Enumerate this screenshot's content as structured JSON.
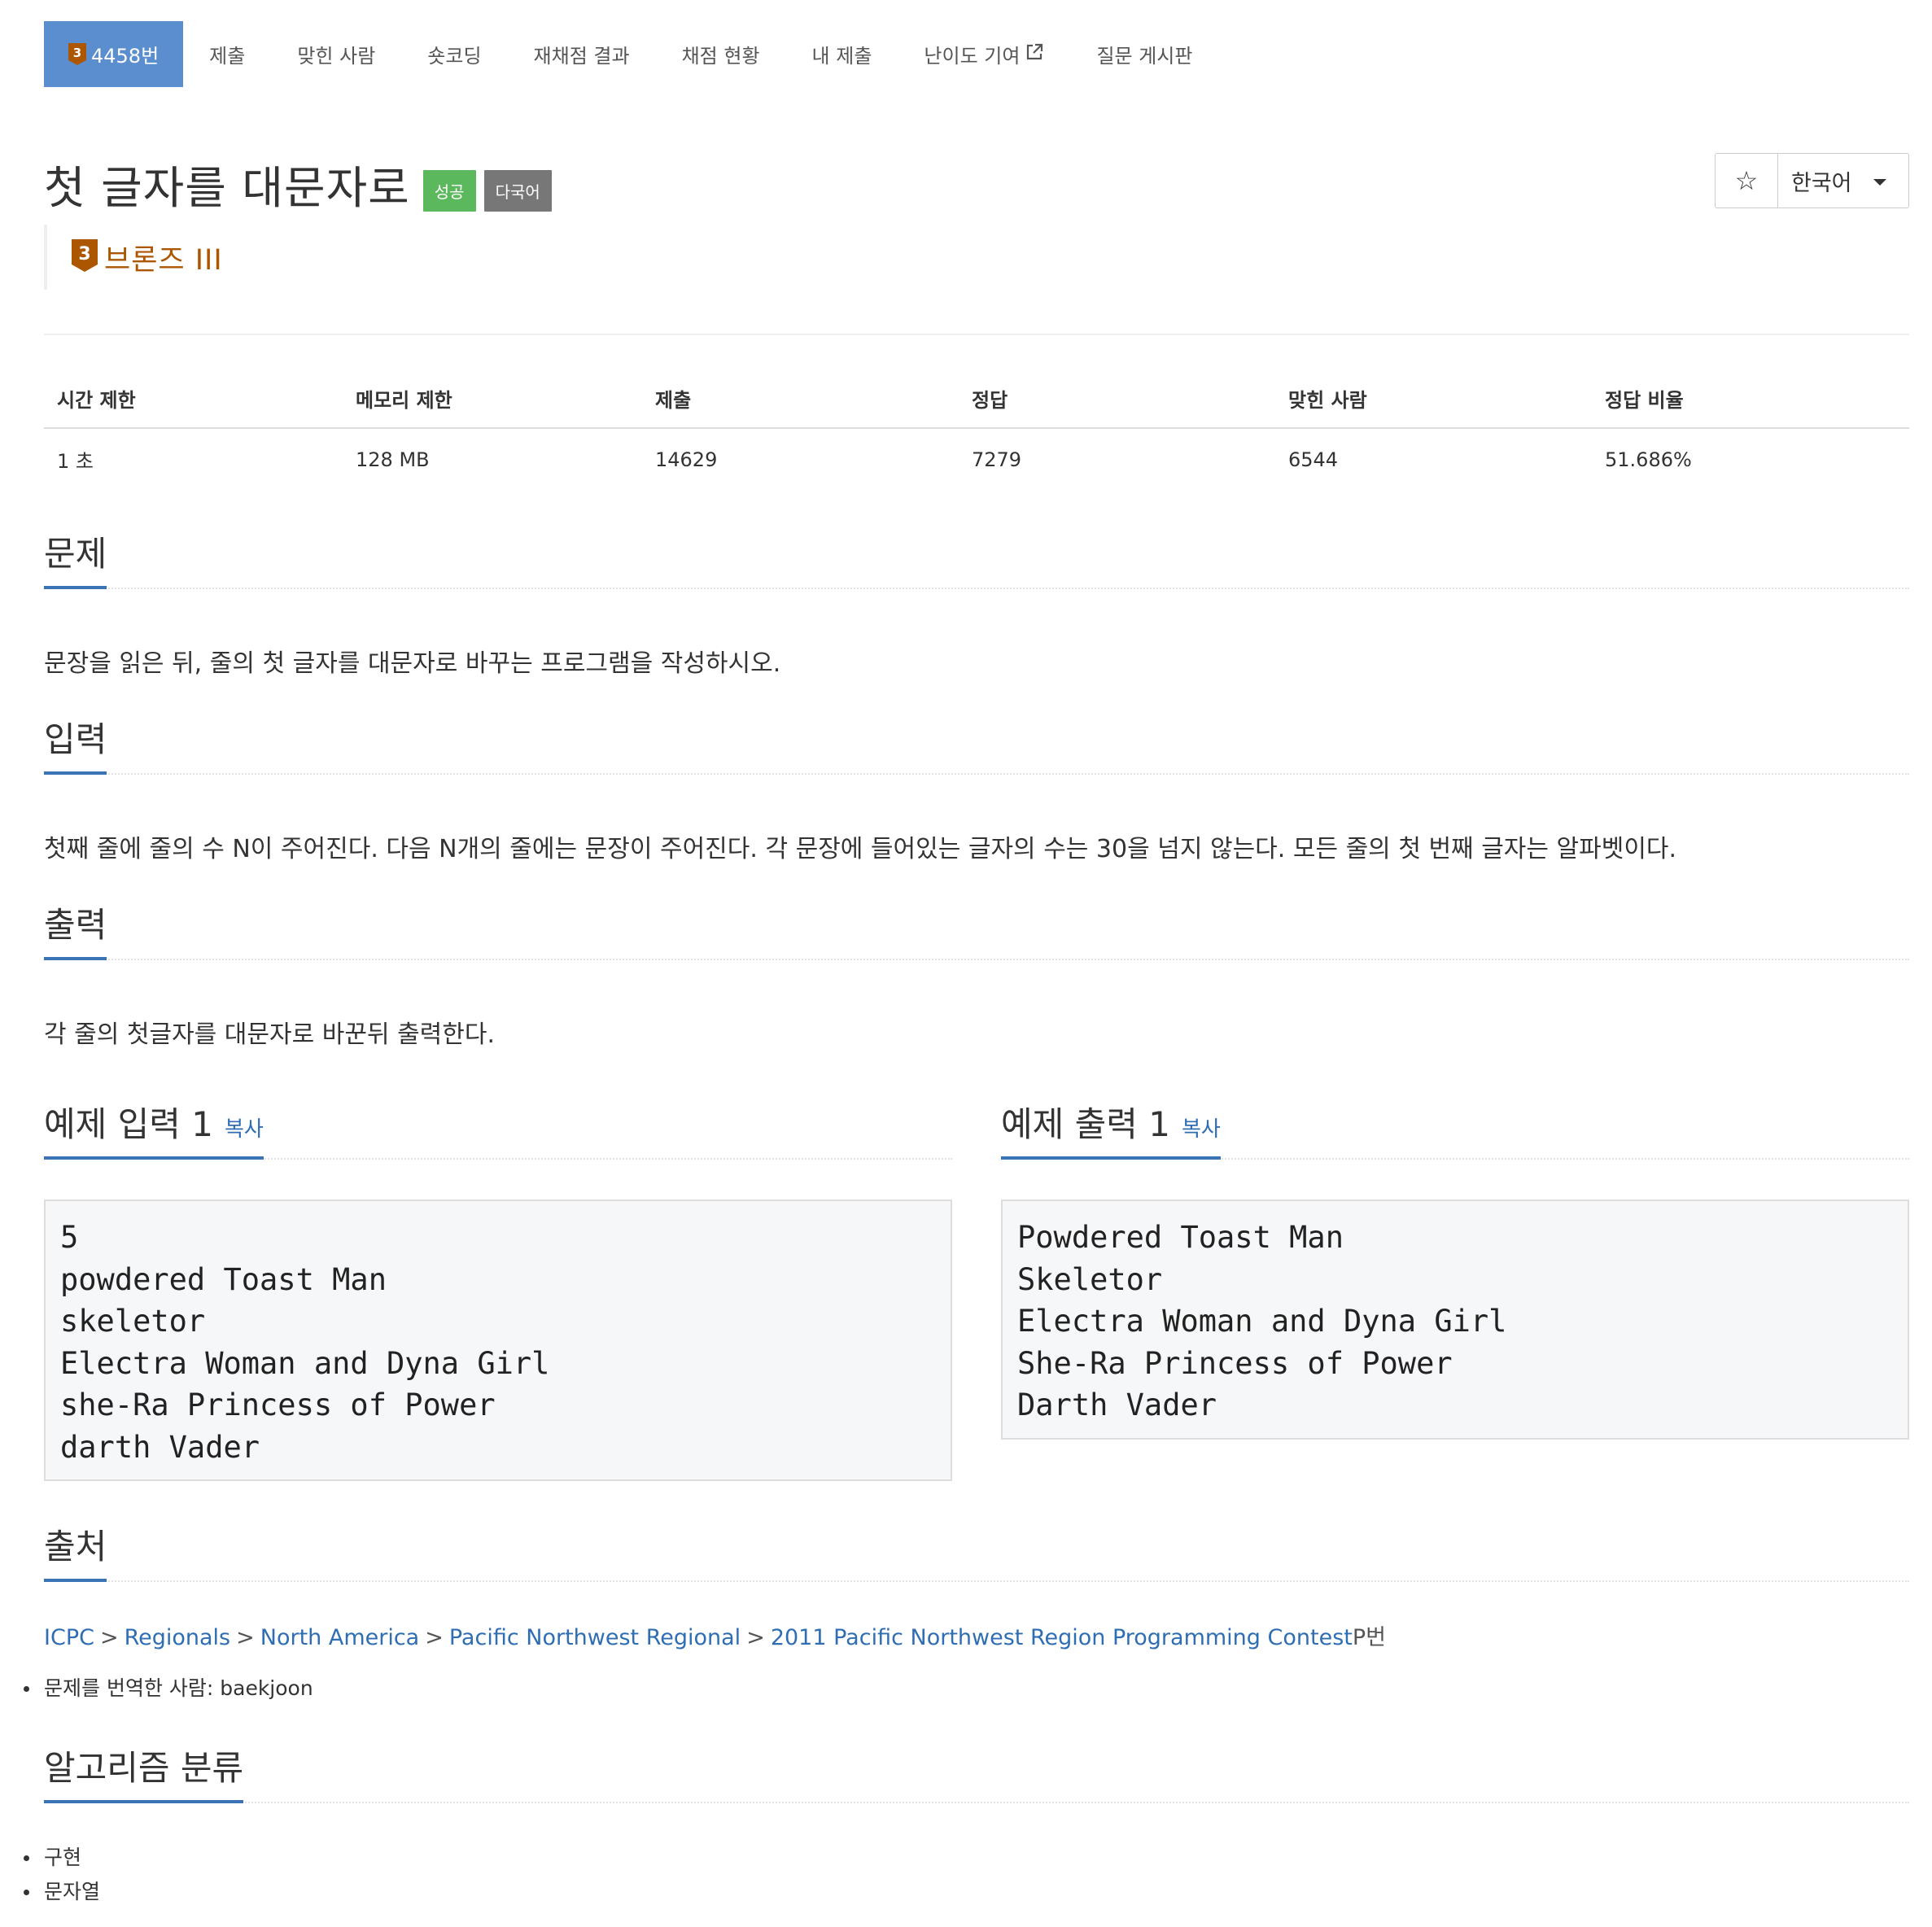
{
  "nav": {
    "items": [
      {
        "label": "4458번",
        "tier_number": "3",
        "active": true
      },
      {
        "label": "제출"
      },
      {
        "label": "맞힌 사람"
      },
      {
        "label": "숏코딩"
      },
      {
        "label": "재채점 결과"
      },
      {
        "label": "채점 현황"
      },
      {
        "label": "내 제출"
      },
      {
        "label": "난이도 기여",
        "icon": "external-link-icon"
      },
      {
        "label": "질문 게시판"
      }
    ]
  },
  "problem": {
    "title": "첫 글자를 대문자로",
    "labels": {
      "success": "성공",
      "multilang": "다국어"
    },
    "tier": {
      "number": "3",
      "text": "브론즈 III",
      "color": "#ad5600"
    }
  },
  "tools": {
    "star_icon": "star-outline-icon",
    "star": "☆",
    "language": "한국어"
  },
  "info": {
    "headers": [
      "시간 제한",
      "메모리 제한",
      "제출",
      "정답",
      "맞힌 사람",
      "정답 비율"
    ],
    "values": [
      "1 초",
      "128 MB",
      "14629",
      "7279",
      "6544",
      "51.686%"
    ]
  },
  "sections": {
    "description": {
      "title": "문제",
      "text": "문장을 읽은 뒤, 줄의 첫 글자를 대문자로 바꾸는 프로그램을 작성하시오."
    },
    "input": {
      "title": "입력",
      "text": "첫째 줄에 줄의 수 N이 주어진다. 다음 N개의 줄에는 문장이 주어진다. 각 문장에 들어있는 글자의 수는 30을 넘지 않는다. 모든 줄의 첫 번째 글자는 알파벳이다."
    },
    "output": {
      "title": "출력",
      "text": "각 줄의 첫글자를 대문자로 바꾼뒤 출력한다."
    }
  },
  "samples": {
    "input": {
      "title": "예제 입력 1",
      "copy": "복사",
      "content": "5\npowdered Toast Man\nskeletor\nElectra Woman and Dyna Girl\nshe-Ra Princess of Power\ndarth Vader"
    },
    "output": {
      "title": "예제 출력 1",
      "copy": "복사",
      "content": "Powdered Toast Man\nSkeletor\nElectra Woman and Dyna Girl\nShe-Ra Princess of Power\nDarth Vader"
    }
  },
  "source": {
    "title": "출처",
    "breadcrumb": [
      "ICPC",
      "Regionals",
      "North America",
      "Pacific Northwest Regional",
      "2011 Pacific Northwest Region Programming Contest"
    ],
    "separator": ">",
    "suffix": "P번",
    "translator": "문제를 번역한 사람: baekjoon"
  },
  "algorithms": {
    "title": "알고리즘 분류",
    "items": [
      "구현",
      "문자열"
    ]
  },
  "colors": {
    "accent": "#3a74b5",
    "nav_active": "#5a8ecf",
    "bronze": "#ad5600",
    "success": "#5cb85c",
    "link": "#2f6eb3"
  }
}
